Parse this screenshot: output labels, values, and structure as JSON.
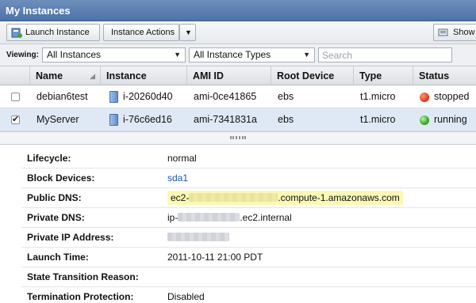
{
  "window": {
    "title": "My Instances"
  },
  "toolbar": {
    "launch_label": "Launch Instance",
    "actions_label": "Instance Actions",
    "show_label": "Show"
  },
  "filters": {
    "viewing_label": "Viewing:",
    "instances_value": "All Instances",
    "types_value": "All Instance Types",
    "search_placeholder": "Search"
  },
  "table": {
    "columns": [
      "Name",
      "Instance",
      "AMI ID",
      "Root Device",
      "Type",
      "Status"
    ],
    "rows": [
      {
        "checked": false,
        "name": "debian6test",
        "instance": "i-20260d40",
        "ami": "ami-0ce41865",
        "root": "ebs",
        "type": "t1.micro",
        "status": "stopped",
        "status_color": "#e0401a"
      },
      {
        "checked": true,
        "name": "MyServer",
        "instance": "i-76c6ed16",
        "ami": "ami-7341831a",
        "root": "ebs",
        "type": "t1.micro",
        "status": "running",
        "status_color": "#3aa82a"
      }
    ],
    "check_glyph": "✔"
  },
  "details": {
    "lifecycle": {
      "label": "Lifecycle:",
      "value": "normal"
    },
    "block_devices": {
      "label": "Block Devices:",
      "value": "sda1"
    },
    "public_dns": {
      "label": "Public DNS:",
      "prefix": "ec2-",
      "suffix": ".compute-1.amazonaws.com"
    },
    "private_dns": {
      "label": "Private DNS:",
      "prefix": "ip-",
      "suffix": ".ec2.internal"
    },
    "private_ip": {
      "label": "Private IP Address:"
    },
    "launch_time": {
      "label": "Launch Time:",
      "value": "2011-10-11 21:00 PDT"
    },
    "transition": {
      "label": "State Transition Reason:",
      "value": ""
    },
    "termination": {
      "label": "Termination Protection:",
      "value": "Disabled"
    }
  },
  "colors": {
    "titlebar": "#5a7db0",
    "selected_row": "#dfe9f5",
    "highlight": "#fbf8b4",
    "link": "#1a57a8"
  }
}
